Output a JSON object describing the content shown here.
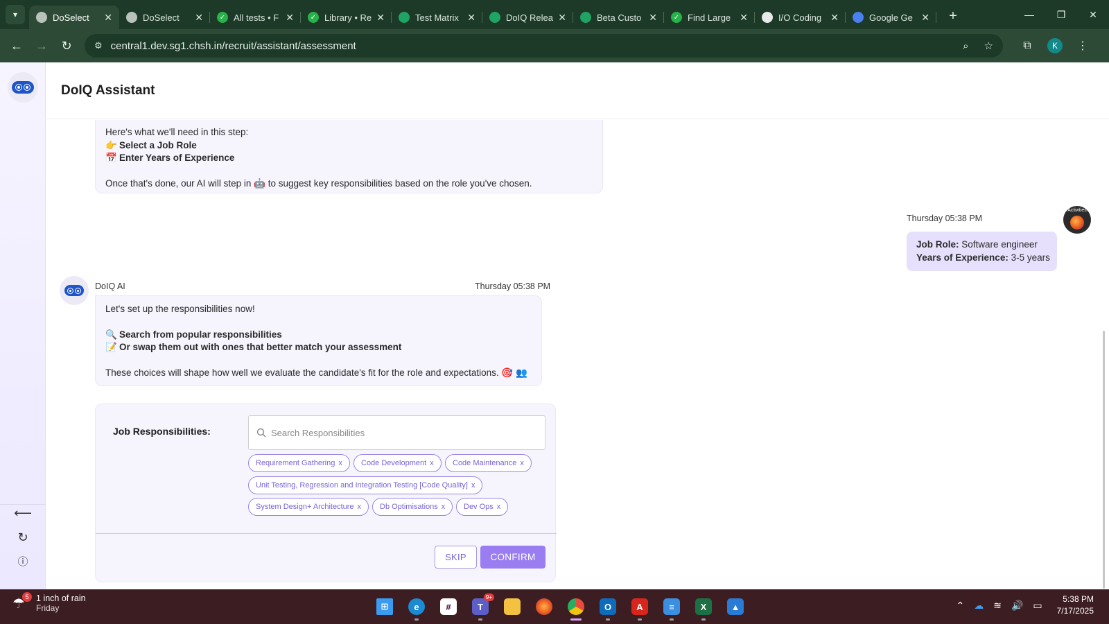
{
  "browser": {
    "tabs": [
      {
        "label": "DoSelect",
        "icon": "doselect-icon",
        "color": "#b9c3bc",
        "active": true
      },
      {
        "label": "DoSelect",
        "icon": "doselect-icon",
        "color": "#b9c3bc"
      },
      {
        "label": "All tests • F",
        "icon": "check-icon",
        "color": "#27b24a"
      },
      {
        "label": "Library • Re",
        "icon": "check-icon",
        "color": "#27b24a"
      },
      {
        "label": "Test Matrix",
        "icon": "sheets-icon",
        "color": "#1fa463"
      },
      {
        "label": "DoIQ Relea",
        "icon": "sheets-icon",
        "color": "#1fa463"
      },
      {
        "label": "Beta Custo",
        "icon": "sheets-icon",
        "color": "#1fa463"
      },
      {
        "label": "Find Large",
        "icon": "check-icon",
        "color": "#27b24a"
      },
      {
        "label": "I/O Coding",
        "icon": "openai-icon",
        "color": "#e9e9e9"
      },
      {
        "label": "Google Ge",
        "icon": "gemini-icon",
        "color": "#4a7ff0"
      }
    ],
    "url": "central1.dev.sg1.chsh.in/recruit/assistant/assessment",
    "profile_initial": "K"
  },
  "app": {
    "title": "DoIQ Assistant"
  },
  "messages": {
    "intro": {
      "lead": "Here's what we'll need in this step:",
      "item1": "Select a Job Role",
      "item2": "Enter Years of Experience",
      "closing": "Once that's done, our AI will step in 🤖 to suggest key responsibilities based on the role you've chosen."
    },
    "user": {
      "time": "Thursday 05:38 PM",
      "role_label": "Job Role:",
      "role_value": "Software engineer",
      "exp_label": "Years of Experience:",
      "exp_value": "3-5 years",
      "avatar_text": "Activities"
    },
    "ai": {
      "name": "DoIQ AI",
      "time": "Thursday 05:38 PM",
      "lead": "Let's set up the responsibilities now!",
      "item1": "Search from popular responsibilities",
      "item2": "Or swap them out with ones that better match your assessment",
      "closing": "These choices will shape how well we evaluate the candidate's fit for the role and expectations. 🎯 👥"
    }
  },
  "form": {
    "label": "Job Responsibilities:",
    "search_placeholder": "Search Responsibilities",
    "chips": [
      "Requirement Gathering",
      "Code Development",
      "Code Maintenance",
      "Unit Testing, Regression and Integration Testing [Code Quality]",
      "System Design+ Architecture",
      "Db Optimisations",
      "Dev Ops"
    ],
    "chip_remove": "x",
    "skip_label": "SKIP",
    "confirm_label": "CONFIRM"
  },
  "taskbar": {
    "weather_main": "1 inch of rain",
    "weather_sub": "Friday",
    "weather_badge": "5",
    "teams_badge": "9+",
    "time": "5:38 PM",
    "date": "7/17/2025"
  },
  "colors": {
    "accent": "#9a7df0",
    "chip_border": "#9b86e8",
    "browser_frame": "#1c3a27",
    "taskbar": "#3c1d22"
  }
}
